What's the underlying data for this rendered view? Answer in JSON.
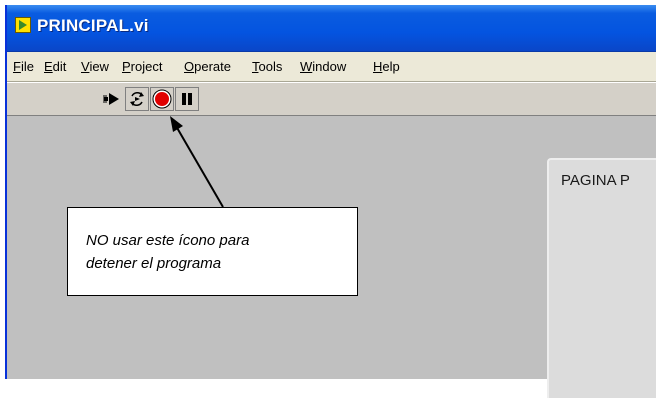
{
  "window": {
    "title": "PRINCIPAL.vi"
  },
  "menu": [
    {
      "label": "File",
      "mnemonic": "F",
      "rest": "ile"
    },
    {
      "label": "Edit",
      "mnemonic": "E",
      "rest": "dit"
    },
    {
      "label": "View",
      "mnemonic": "V",
      "rest": "iew"
    },
    {
      "label": "Project",
      "mnemonic": "P",
      "rest": "roject"
    },
    {
      "label": "Operate",
      "mnemonic": "O",
      "rest": "perate"
    },
    {
      "label": "Tools",
      "mnemonic": "T",
      "rest": "ools"
    },
    {
      "label": "Window",
      "mnemonic": "W",
      "rest": "indow"
    },
    {
      "label": "Help",
      "mnemonic": "H",
      "rest": "elp"
    }
  ],
  "toolbar": {
    "buttons": [
      {
        "icon": "run-arrow-icon"
      },
      {
        "icon": "run-continuously-icon"
      },
      {
        "icon": "abort-execution-icon"
      },
      {
        "icon": "pause-icon"
      }
    ]
  },
  "panel": {
    "frame_label": "PAGINA P"
  },
  "annotation": {
    "line1": "NO usar este ícono para",
    "line2": "detener  el programa"
  },
  "colors": {
    "titlebar": "#0454e0",
    "panel": "#c0c0c0",
    "abort_red": "#e00000"
  }
}
